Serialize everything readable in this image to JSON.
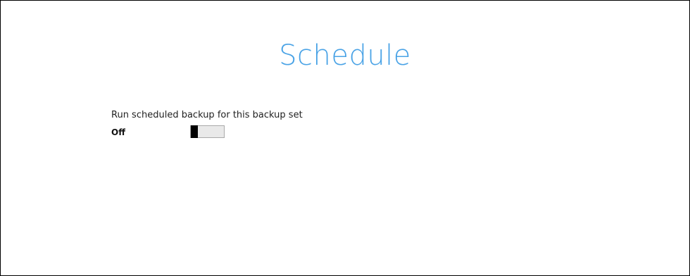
{
  "page": {
    "title": "Schedule"
  },
  "schedule": {
    "run_label": "Run scheduled backup for this backup set",
    "state_text": "Off",
    "enabled": false
  },
  "colors": {
    "title": "#4aa3e6",
    "toggle_track": "#e9e9e9",
    "toggle_thumb": "#000000"
  }
}
